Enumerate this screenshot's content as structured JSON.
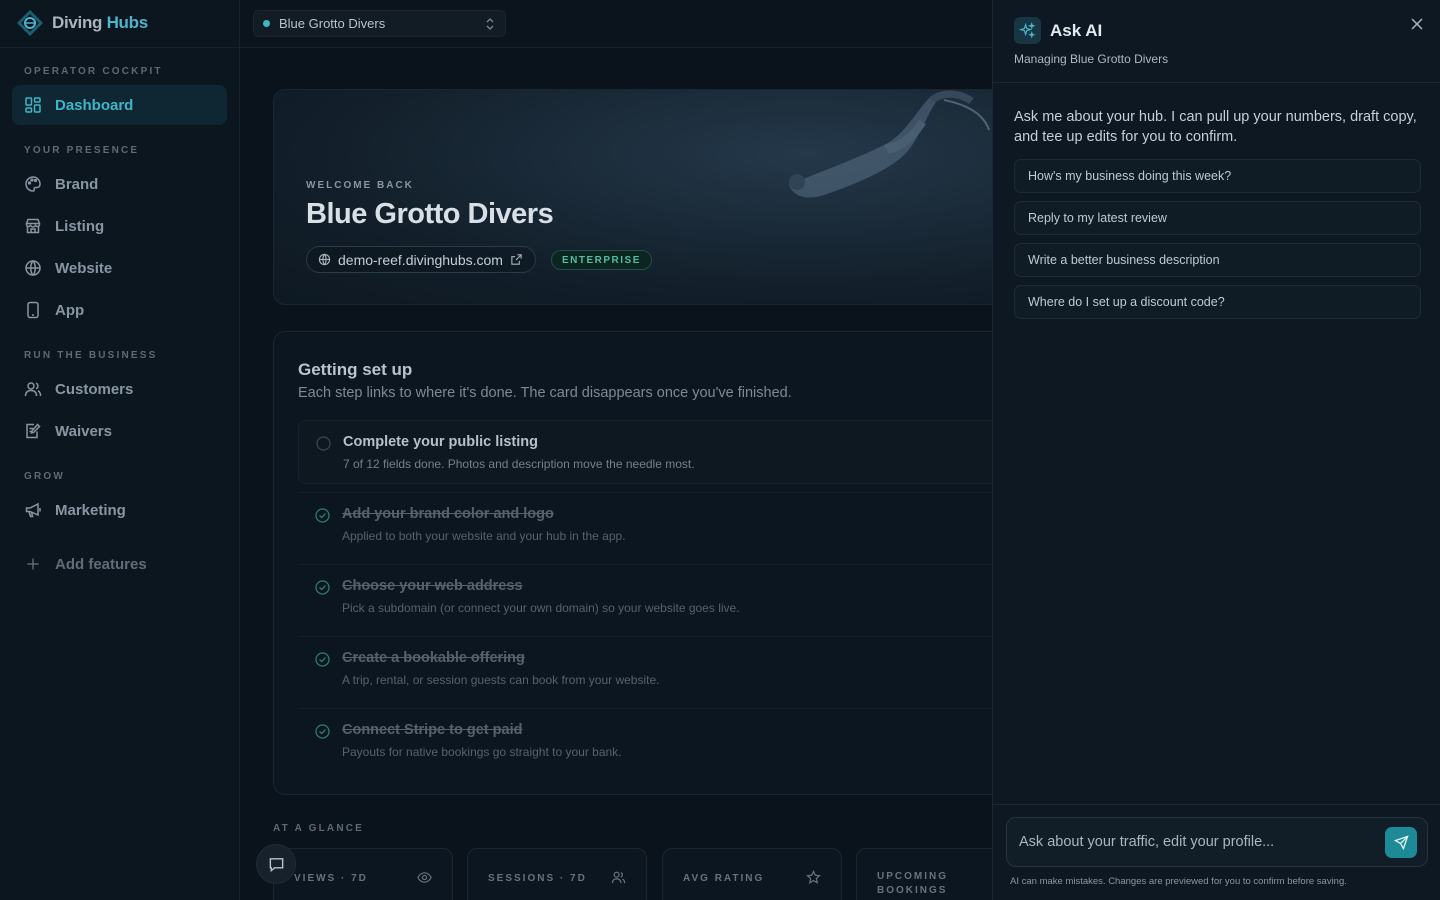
{
  "brand": {
    "name_part1": "Diving ",
    "name_part2": "Hubs"
  },
  "sidebar": {
    "sections": [
      {
        "label": "OPERATOR COCKPIT"
      },
      {
        "label": "YOUR PRESENCE"
      },
      {
        "label": "RUN THE BUSINESS"
      },
      {
        "label": "GROW"
      }
    ],
    "items": [
      {
        "label": "Dashboard",
        "icon": "dashboard-icon"
      },
      {
        "label": "Brand",
        "icon": "palette-icon"
      },
      {
        "label": "Listing",
        "icon": "store-icon"
      },
      {
        "label": "Website",
        "icon": "globe-icon"
      },
      {
        "label": "App",
        "icon": "phone-icon"
      },
      {
        "label": "Customers",
        "icon": "users-icon"
      },
      {
        "label": "Waivers",
        "icon": "document-edit-icon"
      },
      {
        "label": "Marketing",
        "icon": "megaphone-icon"
      },
      {
        "label": "Add features",
        "icon": "plus-icon"
      }
    ]
  },
  "topbar": {
    "hub_name": "Blue Grotto Divers"
  },
  "hero": {
    "kicker": "WELCOME BACK",
    "title": "Blue Grotto Divers",
    "url": "demo-reef.divinghubs.com",
    "tier": "ENTERPRISE"
  },
  "setup": {
    "title": "Getting set up",
    "subtitle": "Each step links to where it's done. The card disappears once you've finished.",
    "steps": [
      {
        "title": "Complete your public listing",
        "desc": "7 of 12 fields done. Photos and description move the needle most.",
        "done": false
      },
      {
        "title": "Add your brand color and logo",
        "desc": "Applied to both your website and your hub in the app.",
        "done": true
      },
      {
        "title": "Choose your web address",
        "desc": "Pick a subdomain (or connect your own domain) so your website goes live.",
        "done": true
      },
      {
        "title": "Create a bookable offering",
        "desc": "A trip, rental, or session guests can book from your website.",
        "done": true
      },
      {
        "title": "Connect Stripe to get paid",
        "desc": "Payouts for native bookings go straight to your bank.",
        "done": true
      }
    ]
  },
  "glance": {
    "label": "AT A GLANCE",
    "stats": [
      {
        "label": "VIEWS · 7D",
        "icon": "eye-icon"
      },
      {
        "label": "SESSIONS · 7D",
        "icon": "users-icon"
      },
      {
        "label": "AVG RATING",
        "icon": "star-icon"
      },
      {
        "label_line1": "UPCOMING",
        "label_line2": "BOOKINGS"
      }
    ]
  },
  "ai": {
    "title": "Ask AI",
    "subtitle": "Managing Blue Grotto Divers",
    "intro": "Ask me about your hub. I can pull up your numbers, draft copy, and tee up edits for you to confirm.",
    "suggestions": [
      "How's my business doing this week?",
      "Reply to my latest review",
      "Write a better business description",
      "Where do I set up a discount code?"
    ],
    "input_placeholder": "Ask about your traffic, edit your profile...",
    "disclaimer": "AI can make mistakes. Changes are previewed for you to confirm before saving."
  },
  "colors": {
    "accent": "#3fb5c8",
    "success": "#4fbf9d",
    "send_button": "#1d8a98"
  }
}
